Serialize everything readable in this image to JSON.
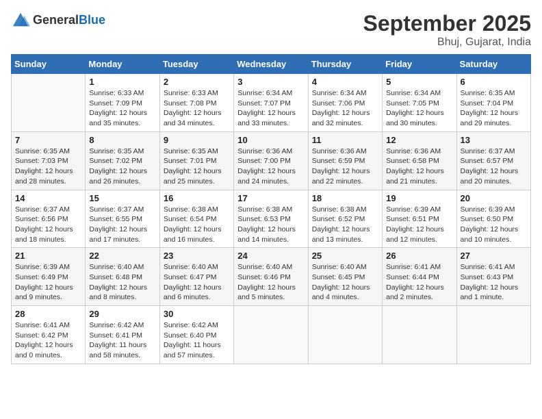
{
  "logo": {
    "general": "General",
    "blue": "Blue"
  },
  "header": {
    "month": "September 2025",
    "location": "Bhuj, Gujarat, India"
  },
  "days_of_week": [
    "Sunday",
    "Monday",
    "Tuesday",
    "Wednesday",
    "Thursday",
    "Friday",
    "Saturday"
  ],
  "weeks": [
    [
      {
        "num": "",
        "lines": []
      },
      {
        "num": "1",
        "lines": [
          "Sunrise: 6:33 AM",
          "Sunset: 7:09 PM",
          "Daylight: 12 hours",
          "and 35 minutes."
        ]
      },
      {
        "num": "2",
        "lines": [
          "Sunrise: 6:33 AM",
          "Sunset: 7:08 PM",
          "Daylight: 12 hours",
          "and 34 minutes."
        ]
      },
      {
        "num": "3",
        "lines": [
          "Sunrise: 6:34 AM",
          "Sunset: 7:07 PM",
          "Daylight: 12 hours",
          "and 33 minutes."
        ]
      },
      {
        "num": "4",
        "lines": [
          "Sunrise: 6:34 AM",
          "Sunset: 7:06 PM",
          "Daylight: 12 hours",
          "and 32 minutes."
        ]
      },
      {
        "num": "5",
        "lines": [
          "Sunrise: 6:34 AM",
          "Sunset: 7:05 PM",
          "Daylight: 12 hours",
          "and 30 minutes."
        ]
      },
      {
        "num": "6",
        "lines": [
          "Sunrise: 6:35 AM",
          "Sunset: 7:04 PM",
          "Daylight: 12 hours",
          "and 29 minutes."
        ]
      }
    ],
    [
      {
        "num": "7",
        "lines": [
          "Sunrise: 6:35 AM",
          "Sunset: 7:03 PM",
          "Daylight: 12 hours",
          "and 28 minutes."
        ]
      },
      {
        "num": "8",
        "lines": [
          "Sunrise: 6:35 AM",
          "Sunset: 7:02 PM",
          "Daylight: 12 hours",
          "and 26 minutes."
        ]
      },
      {
        "num": "9",
        "lines": [
          "Sunrise: 6:35 AM",
          "Sunset: 7:01 PM",
          "Daylight: 12 hours",
          "and 25 minutes."
        ]
      },
      {
        "num": "10",
        "lines": [
          "Sunrise: 6:36 AM",
          "Sunset: 7:00 PM",
          "Daylight: 12 hours",
          "and 24 minutes."
        ]
      },
      {
        "num": "11",
        "lines": [
          "Sunrise: 6:36 AM",
          "Sunset: 6:59 PM",
          "Daylight: 12 hours",
          "and 22 minutes."
        ]
      },
      {
        "num": "12",
        "lines": [
          "Sunrise: 6:36 AM",
          "Sunset: 6:58 PM",
          "Daylight: 12 hours",
          "and 21 minutes."
        ]
      },
      {
        "num": "13",
        "lines": [
          "Sunrise: 6:37 AM",
          "Sunset: 6:57 PM",
          "Daylight: 12 hours",
          "and 20 minutes."
        ]
      }
    ],
    [
      {
        "num": "14",
        "lines": [
          "Sunrise: 6:37 AM",
          "Sunset: 6:56 PM",
          "Daylight: 12 hours",
          "and 18 minutes."
        ]
      },
      {
        "num": "15",
        "lines": [
          "Sunrise: 6:37 AM",
          "Sunset: 6:55 PM",
          "Daylight: 12 hours",
          "and 17 minutes."
        ]
      },
      {
        "num": "16",
        "lines": [
          "Sunrise: 6:38 AM",
          "Sunset: 6:54 PM",
          "Daylight: 12 hours",
          "and 16 minutes."
        ]
      },
      {
        "num": "17",
        "lines": [
          "Sunrise: 6:38 AM",
          "Sunset: 6:53 PM",
          "Daylight: 12 hours",
          "and 14 minutes."
        ]
      },
      {
        "num": "18",
        "lines": [
          "Sunrise: 6:38 AM",
          "Sunset: 6:52 PM",
          "Daylight: 12 hours",
          "and 13 minutes."
        ]
      },
      {
        "num": "19",
        "lines": [
          "Sunrise: 6:39 AM",
          "Sunset: 6:51 PM",
          "Daylight: 12 hours",
          "and 12 minutes."
        ]
      },
      {
        "num": "20",
        "lines": [
          "Sunrise: 6:39 AM",
          "Sunset: 6:50 PM",
          "Daylight: 12 hours",
          "and 10 minutes."
        ]
      }
    ],
    [
      {
        "num": "21",
        "lines": [
          "Sunrise: 6:39 AM",
          "Sunset: 6:49 PM",
          "Daylight: 12 hours",
          "and 9 minutes."
        ]
      },
      {
        "num": "22",
        "lines": [
          "Sunrise: 6:40 AM",
          "Sunset: 6:48 PM",
          "Daylight: 12 hours",
          "and 8 minutes."
        ]
      },
      {
        "num": "23",
        "lines": [
          "Sunrise: 6:40 AM",
          "Sunset: 6:47 PM",
          "Daylight: 12 hours",
          "and 6 minutes."
        ]
      },
      {
        "num": "24",
        "lines": [
          "Sunrise: 6:40 AM",
          "Sunset: 6:46 PM",
          "Daylight: 12 hours",
          "and 5 minutes."
        ]
      },
      {
        "num": "25",
        "lines": [
          "Sunrise: 6:40 AM",
          "Sunset: 6:45 PM",
          "Daylight: 12 hours",
          "and 4 minutes."
        ]
      },
      {
        "num": "26",
        "lines": [
          "Sunrise: 6:41 AM",
          "Sunset: 6:44 PM",
          "Daylight: 12 hours",
          "and 2 minutes."
        ]
      },
      {
        "num": "27",
        "lines": [
          "Sunrise: 6:41 AM",
          "Sunset: 6:43 PM",
          "Daylight: 12 hours",
          "and 1 minute."
        ]
      }
    ],
    [
      {
        "num": "28",
        "lines": [
          "Sunrise: 6:41 AM",
          "Sunset: 6:42 PM",
          "Daylight: 12 hours",
          "and 0 minutes."
        ]
      },
      {
        "num": "29",
        "lines": [
          "Sunrise: 6:42 AM",
          "Sunset: 6:41 PM",
          "Daylight: 11 hours",
          "and 58 minutes."
        ]
      },
      {
        "num": "30",
        "lines": [
          "Sunrise: 6:42 AM",
          "Sunset: 6:40 PM",
          "Daylight: 11 hours",
          "and 57 minutes."
        ]
      },
      {
        "num": "",
        "lines": []
      },
      {
        "num": "",
        "lines": []
      },
      {
        "num": "",
        "lines": []
      },
      {
        "num": "",
        "lines": []
      }
    ]
  ]
}
